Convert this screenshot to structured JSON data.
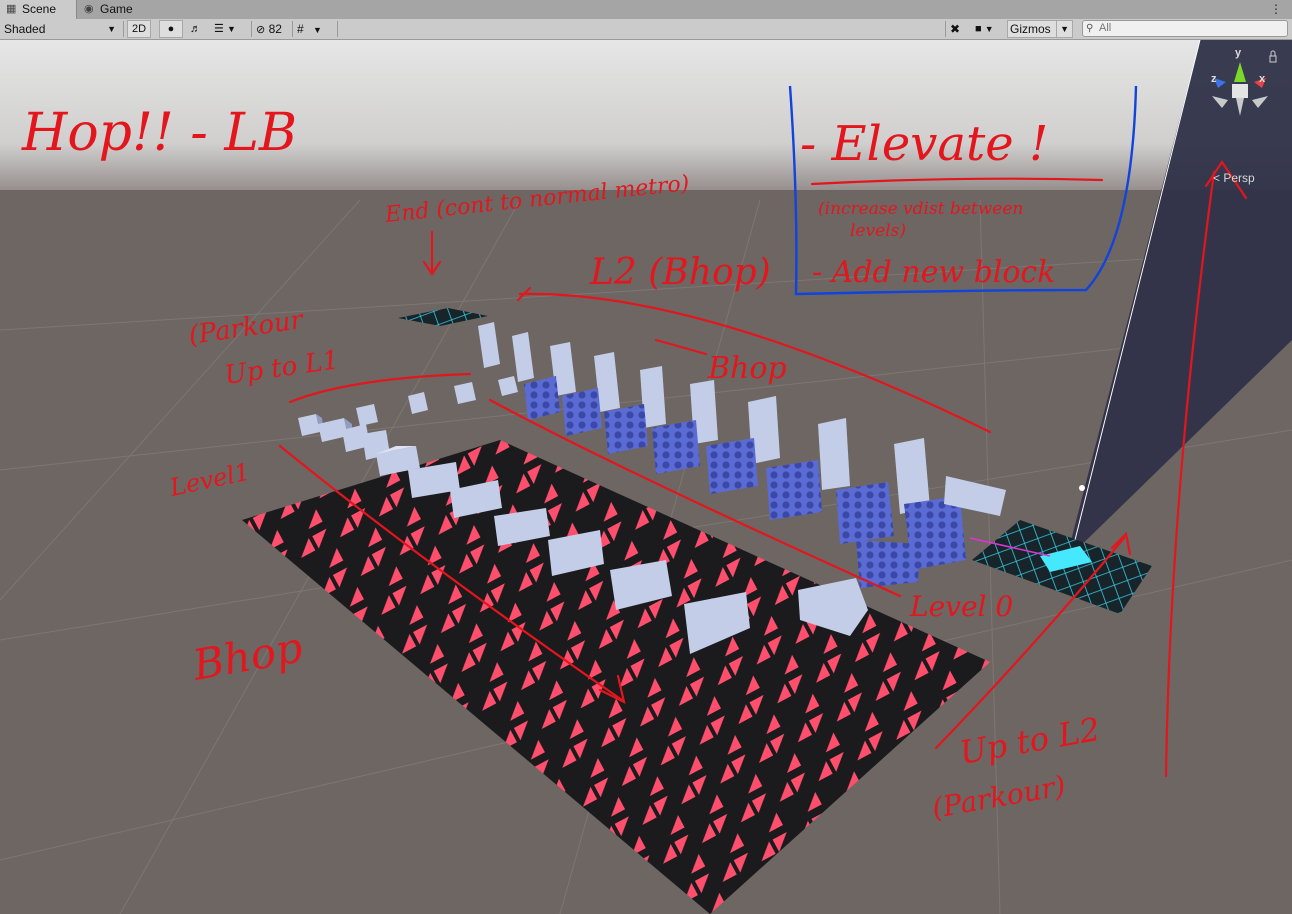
{
  "tabs": [
    {
      "label": "Scene",
      "icon": "grid-icon",
      "active": true
    },
    {
      "label": "Game",
      "icon": "gamepad-icon",
      "active": false
    }
  ],
  "toolbar": {
    "shading_mode": "Shaded",
    "mode_2d": "2D",
    "hidden_count": "82",
    "gizmos": "Gizmos",
    "search_placeholder": "All"
  },
  "gizmo": {
    "projection": "Persp",
    "axes": {
      "y": "y",
      "x": "x",
      "z": "z"
    }
  },
  "annotations": {
    "title": "Hop!! - LB",
    "elevate": "- Elevate !",
    "increase": "(increase vdist between",
    "levels": "levels)",
    "add_block": "- Add new block",
    "end": "End (cont to normal metro)",
    "l2_bhop": "L2 (Bhop)",
    "parkour_l1_a": "(Parkour",
    "parkour_l1_b": "Up to L1",
    "bhop_top": "Bhop",
    "level1": "Level1",
    "level0": "Level 0",
    "bhop_floor": "Bhop",
    "up_l2_a": "Up to L2",
    "up_l2_b": "(Parkour)"
  },
  "colors": {
    "sky": "#d9d9d9",
    "ground": "#6e6663",
    "floor": "#1b1b1e",
    "triangle": "#ff4f6d",
    "block": "#c3cde7",
    "ink_red": "#e2161c",
    "ink_blue": "#1144dd",
    "portal": "#33e6ff"
  }
}
